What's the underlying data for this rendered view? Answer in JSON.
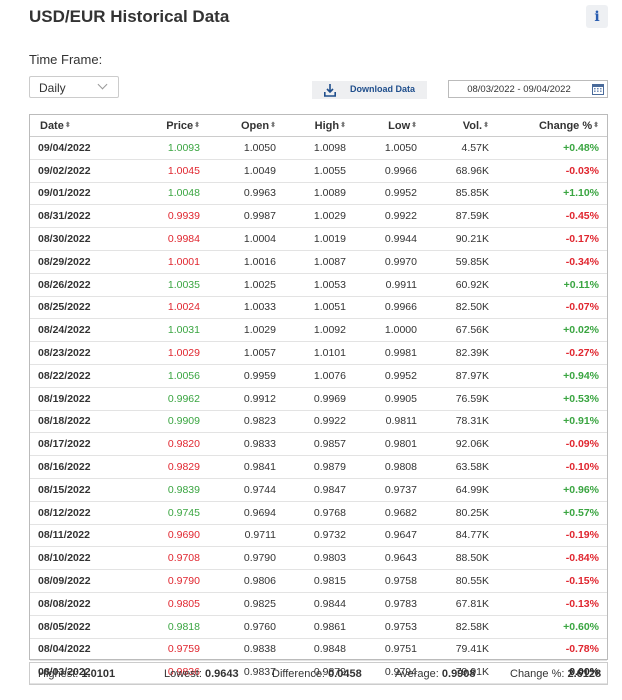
{
  "title": "USD/EUR Historical Data",
  "timeframe": {
    "label": "Time Frame:",
    "value": "Daily"
  },
  "download_label": "Download Data",
  "date_range": "08/03/2022 - 09/04/2022",
  "columns": [
    "Date",
    "Price",
    "Open",
    "High",
    "Low",
    "Vol.",
    "Change %"
  ],
  "rows": [
    {
      "date": "09/04/2022",
      "price": "1.0093",
      "open": "1.0050",
      "high": "1.0098",
      "low": "1.0050",
      "vol": "4.57K",
      "change": "+0.48%"
    },
    {
      "date": "09/02/2022",
      "price": "1.0045",
      "open": "1.0049",
      "high": "1.0055",
      "low": "0.9966",
      "vol": "68.96K",
      "change": "-0.03%"
    },
    {
      "date": "09/01/2022",
      "price": "1.0048",
      "open": "0.9963",
      "high": "1.0089",
      "low": "0.9952",
      "vol": "85.85K",
      "change": "+1.10%"
    },
    {
      "date": "08/31/2022",
      "price": "0.9939",
      "open": "0.9987",
      "high": "1.0029",
      "low": "0.9922",
      "vol": "87.59K",
      "change": "-0.45%"
    },
    {
      "date": "08/30/2022",
      "price": "0.9984",
      "open": "1.0004",
      "high": "1.0019",
      "low": "0.9944",
      "vol": "90.21K",
      "change": "-0.17%"
    },
    {
      "date": "08/29/2022",
      "price": "1.0001",
      "open": "1.0016",
      "high": "1.0087",
      "low": "0.9970",
      "vol": "59.85K",
      "change": "-0.34%"
    },
    {
      "date": "08/26/2022",
      "price": "1.0035",
      "open": "1.0025",
      "high": "1.0053",
      "low": "0.9911",
      "vol": "60.92K",
      "change": "+0.11%"
    },
    {
      "date": "08/25/2022",
      "price": "1.0024",
      "open": "1.0033",
      "high": "1.0051",
      "low": "0.9966",
      "vol": "82.50K",
      "change": "-0.07%"
    },
    {
      "date": "08/24/2022",
      "price": "1.0031",
      "open": "1.0029",
      "high": "1.0092",
      "low": "1.0000",
      "vol": "67.56K",
      "change": "+0.02%"
    },
    {
      "date": "08/23/2022",
      "price": "1.0029",
      "open": "1.0057",
      "high": "1.0101",
      "low": "0.9981",
      "vol": "82.39K",
      "change": "-0.27%"
    },
    {
      "date": "08/22/2022",
      "price": "1.0056",
      "open": "0.9959",
      "high": "1.0076",
      "low": "0.9952",
      "vol": "87.97K",
      "change": "+0.94%"
    },
    {
      "date": "08/19/2022",
      "price": "0.9962",
      "open": "0.9912",
      "high": "0.9969",
      "low": "0.9905",
      "vol": "76.59K",
      "change": "+0.53%"
    },
    {
      "date": "08/18/2022",
      "price": "0.9909",
      "open": "0.9823",
      "high": "0.9922",
      "low": "0.9811",
      "vol": "78.31K",
      "change": "+0.91%"
    },
    {
      "date": "08/17/2022",
      "price": "0.9820",
      "open": "0.9833",
      "high": "0.9857",
      "low": "0.9801",
      "vol": "92.06K",
      "change": "-0.09%"
    },
    {
      "date": "08/16/2022",
      "price": "0.9829",
      "open": "0.9841",
      "high": "0.9879",
      "low": "0.9808",
      "vol": "63.58K",
      "change": "-0.10%"
    },
    {
      "date": "08/15/2022",
      "price": "0.9839",
      "open": "0.9744",
      "high": "0.9847",
      "low": "0.9737",
      "vol": "64.99K",
      "change": "+0.96%"
    },
    {
      "date": "08/12/2022",
      "price": "0.9745",
      "open": "0.9694",
      "high": "0.9768",
      "low": "0.9682",
      "vol": "80.25K",
      "change": "+0.57%"
    },
    {
      "date": "08/11/2022",
      "price": "0.9690",
      "open": "0.9711",
      "high": "0.9732",
      "low": "0.9647",
      "vol": "84.77K",
      "change": "-0.19%"
    },
    {
      "date": "08/10/2022",
      "price": "0.9708",
      "open": "0.9790",
      "high": "0.9803",
      "low": "0.9643",
      "vol": "88.50K",
      "change": "-0.84%"
    },
    {
      "date": "08/09/2022",
      "price": "0.9790",
      "open": "0.9806",
      "high": "0.9815",
      "low": "0.9758",
      "vol": "80.55K",
      "change": "-0.15%"
    },
    {
      "date": "08/08/2022",
      "price": "0.9805",
      "open": "0.9825",
      "high": "0.9844",
      "low": "0.9783",
      "vol": "67.81K",
      "change": "-0.13%"
    },
    {
      "date": "08/05/2022",
      "price": "0.9818",
      "open": "0.9760",
      "high": "0.9861",
      "low": "0.9753",
      "vol": "82.58K",
      "change": "+0.60%"
    },
    {
      "date": "08/04/2022",
      "price": "0.9759",
      "open": "0.9838",
      "high": "0.9848",
      "low": "0.9751",
      "vol": "79.41K",
      "change": "-0.78%"
    },
    {
      "date": "08/03/2022",
      "price": "0.9836",
      "open": "0.9837",
      "high": "0.9879",
      "low": "0.9794",
      "vol": "79.91K",
      "change": "0.00%"
    }
  ],
  "summary": {
    "highest_label": "Highest:",
    "highest": "1.0101",
    "lowest_label": "Lowest:",
    "lowest": "0.9643",
    "difference_label": "Difference:",
    "difference": "0.0458",
    "average_label": "Average:",
    "average": "0.9908",
    "change_label": "Change %:",
    "change": "2.6128"
  },
  "colors": {
    "up": "#3aa541",
    "down": "#e0262f",
    "link": "#1f4e8c"
  }
}
